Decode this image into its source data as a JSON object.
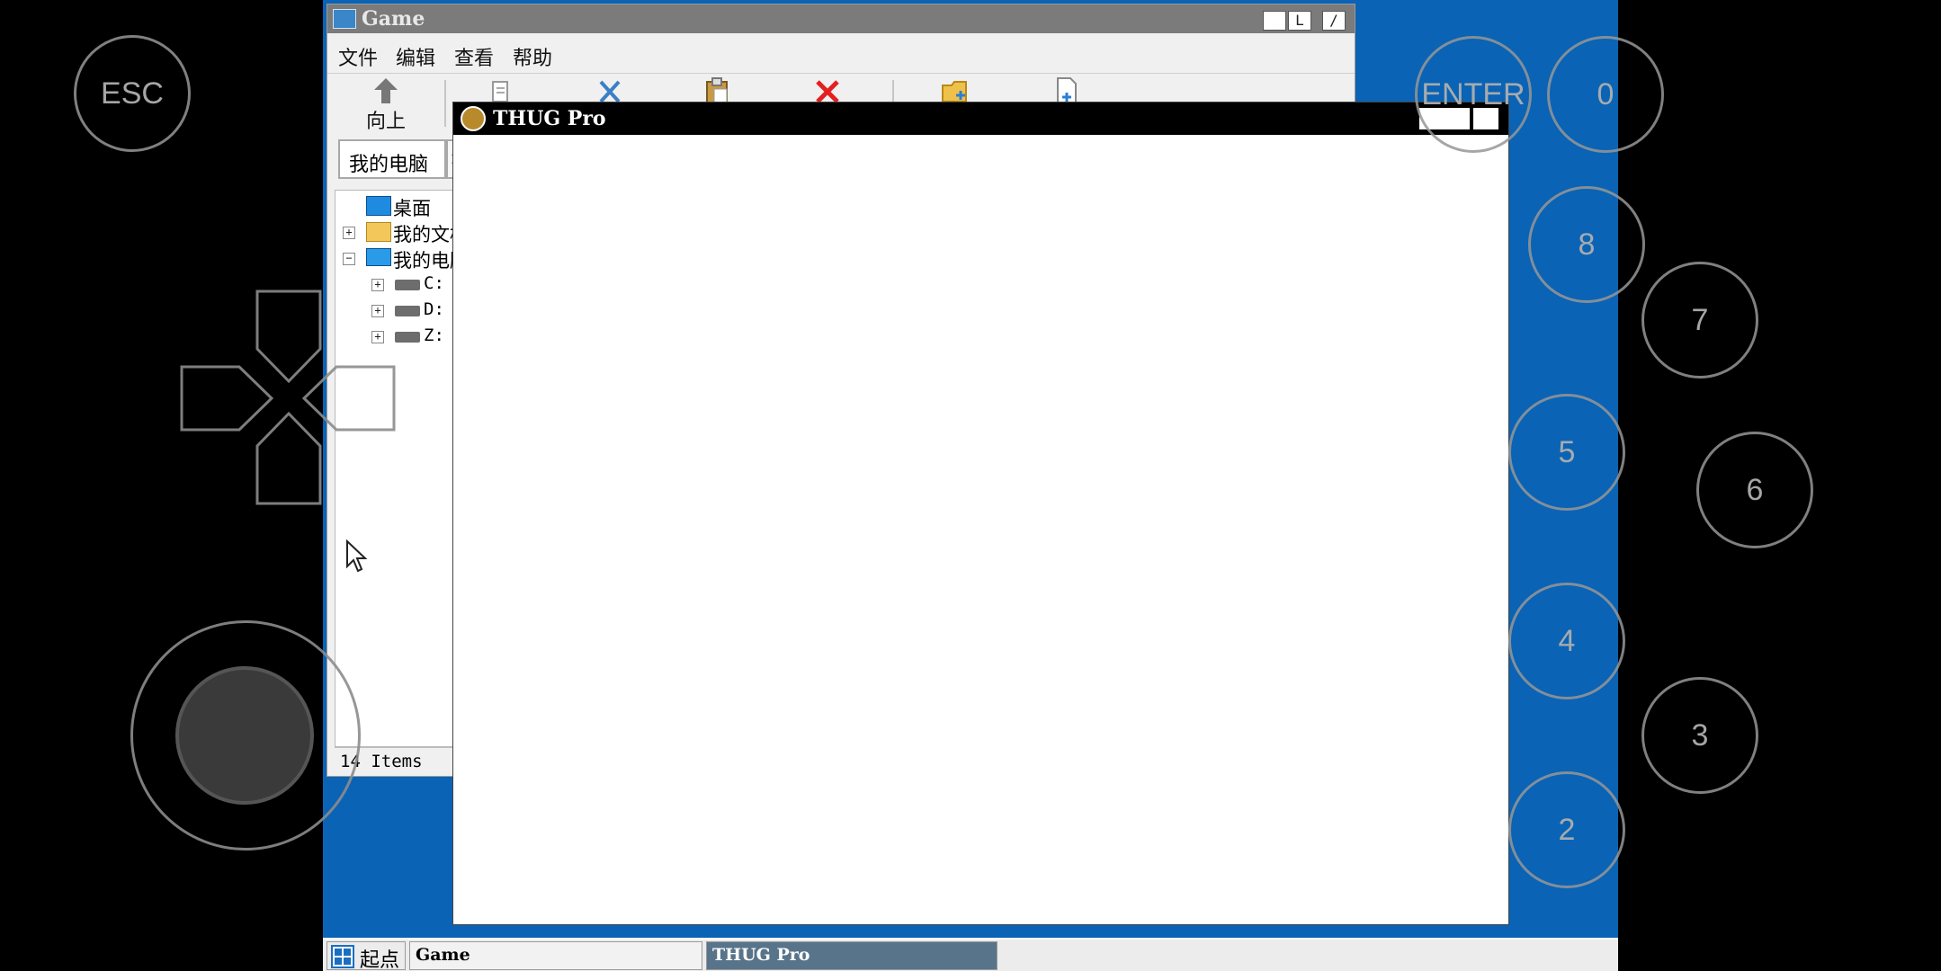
{
  "explorer": {
    "title": "Game",
    "title_buttons": [
      "",
      "L",
      "/"
    ],
    "menu": [
      "文件",
      "编辑",
      "查看",
      "帮助"
    ],
    "toolbar": {
      "up_label": "向上"
    },
    "address": "我的电脑",
    "tree": {
      "desktop": "桌面",
      "my_documents": "我的文档",
      "my_computer": "我的电脑",
      "drives": [
        "C:",
        "D:",
        "Z:"
      ]
    },
    "status": "14 Items"
  },
  "thug_window": {
    "title": "THUG Pro"
  },
  "taskbar": {
    "start_label": "起点",
    "tasks": [
      "Game",
      "THUG Pro"
    ]
  },
  "controls": {
    "esc": "ESC",
    "enter": "ENTER",
    "keys": [
      "0",
      "8",
      "7",
      "5",
      "6",
      "4",
      "3",
      "2"
    ]
  },
  "colors": {
    "desktop": "#0a63b4",
    "thug_title": "#000000",
    "explorer_title": "#7b7b7b"
  }
}
